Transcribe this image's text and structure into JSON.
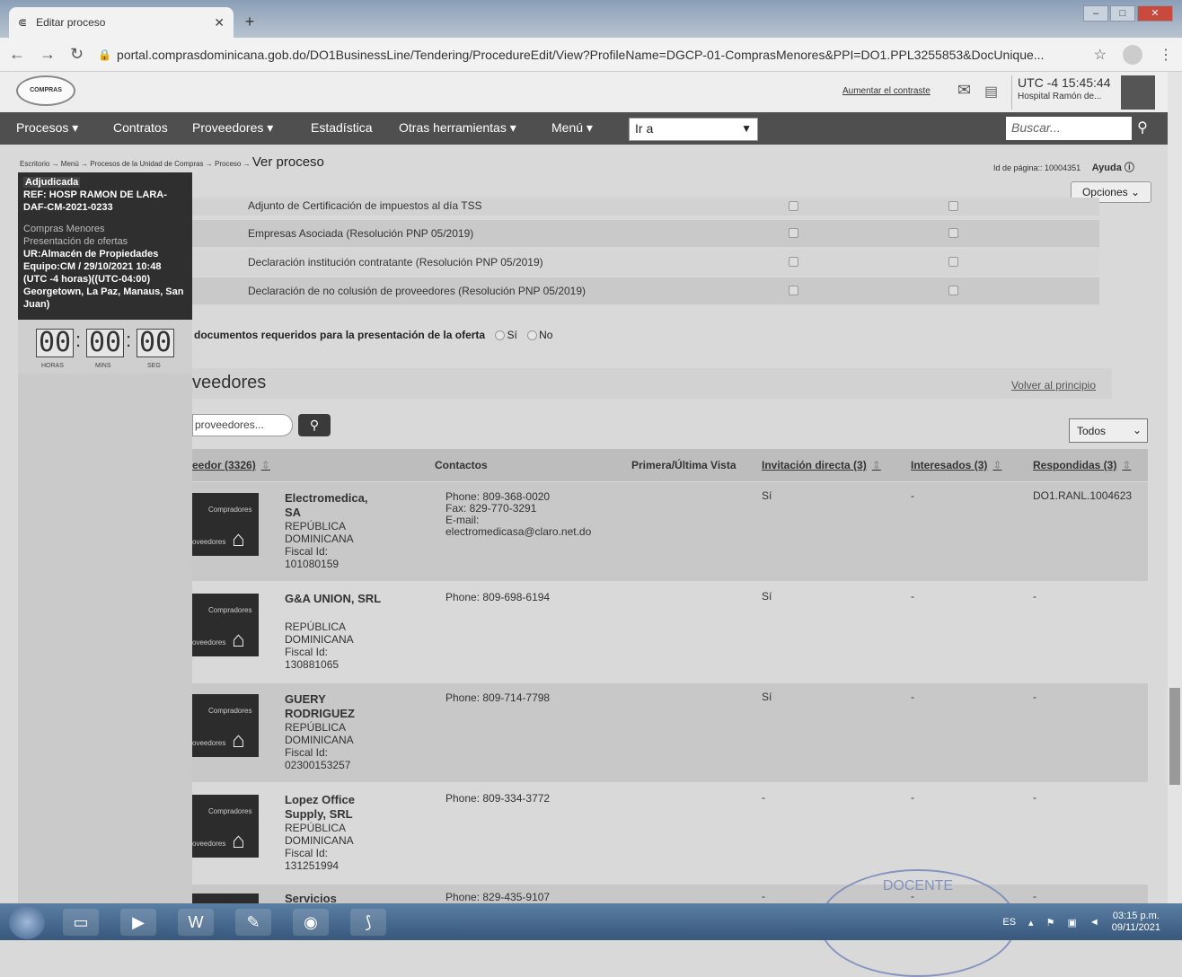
{
  "browser": {
    "tab_title": "Editar proceso",
    "url": "portal.comprasdominicana.gob.do/DO1BusinessLine/Tendering/ProcedureEdit/View?ProfileName=DGCP-01-ComprasMenores&PPI=DO1.PPL3255853&DocUnique..."
  },
  "header": {
    "logo_text": "COMPRAS DOMINICANA",
    "contrast_link": "Aumentar el contraste",
    "utc_time": "UTC -4 15:45:44",
    "hospital": "Hospital Ramón de..."
  },
  "menu": {
    "items": [
      "Procesos",
      "Contratos",
      "Proveedores",
      "Estadística",
      "Otras herramientas",
      "Menú"
    ],
    "goto_value": "Ir a",
    "search_placeholder": "Buscar..."
  },
  "breadcrumb": {
    "items": [
      "Escritorio",
      "Menú",
      "Procesos de la Unidad de Compras",
      "Proceso"
    ],
    "current": "Ver proceso",
    "page_id_label": "Id de página:: 10004351",
    "help": "Ayuda"
  },
  "options_label": "Opciones",
  "info_panel": {
    "status": "Adjudicada",
    "ref": "REF: HOSP RAMON DE LARA-DAF-CM-2021-0233",
    "type": "Compras Menores",
    "phase": "Presentación de ofertas",
    "unit": "UR:Almacén de Propiedades Equipo:CM / 29/10/2021 10:48 (UTC -4 horas)((UTC-04:00) Georgetown, La Paz, Manaus, San Juan)"
  },
  "timer": {
    "hours": "00",
    "mins": "00",
    "secs": "00",
    "label_hours": "HORAS",
    "label_mins": "MINS",
    "label_secs": "SEG"
  },
  "documents": [
    "Adjunto de Certificación de impuestos al día TSS",
    "Empresas Asociada (Resolución PNP 05/2019)",
    "Declaración institución contratante (Resolución PNP 05/2019)",
    "Declaración de no colusión de proveedores (Resolución PNP 05/2019)"
  ],
  "required_question": {
    "text": "documentos requeridos para la presentación de la oferta",
    "yes": "Sí",
    "no": "No"
  },
  "providers_section": {
    "title": "veedores",
    "back_to_top": "Volver al principio",
    "search_value": "proveedores...",
    "filter_value": "Todos"
  },
  "table": {
    "headers": {
      "provider": "eedor (3326)",
      "contacts": "Contactos",
      "first_last_view": "Primera/Última Vista",
      "direct_invitation": "Invitación directa (3)",
      "interested": "Interesados (3)",
      "responded": "Respondidas (3)"
    },
    "logo_text_top": "Compradores",
    "logo_text_bottom": "oveedores",
    "rows": [
      {
        "name": "Electromedica, SA",
        "country": "REPÚBLICA DOMINICANA",
        "fiscal_label": "Fiscal Id:",
        "fiscal_id": "101080159",
        "phone": "Phone: 809-368-0020",
        "fax": "Fax: 829-770-3291",
        "email_label": "E-mail:",
        "email": "electromedicasa@claro.net.do",
        "invited": "Sí",
        "interested": "-",
        "responded": "DO1.RANL.1004623"
      },
      {
        "name": "G&A UNION, SRL",
        "country": "REPÚBLICA DOMINICANA",
        "fiscal_label": "Fiscal Id:",
        "fiscal_id": "130881065",
        "phone": "Phone: 809-698-6194",
        "invited": "Sí",
        "interested": "-",
        "responded": "-"
      },
      {
        "name": "GUERY RODRIGUEZ",
        "country": "REPÚBLICA DOMINICANA",
        "fiscal_label": "Fiscal Id:",
        "fiscal_id": "02300153257",
        "phone": "Phone: 809-714-7798",
        "invited": "Sí",
        "interested": "-",
        "responded": "-"
      },
      {
        "name": "Lopez Office Supply, SRL",
        "country": "REPÚBLICA DOMINICANA",
        "fiscal_label": "Fiscal Id:",
        "fiscal_id": "131251994",
        "phone": "Phone: 809-334-3772",
        "invited": "-",
        "interested": "-",
        "responded": "-"
      },
      {
        "name": "Servicios",
        "phone": "Phone: 829-435-9107",
        "invited": "-",
        "interested": "-",
        "responded": "-"
      }
    ]
  },
  "stamp_text": "DOCENTE",
  "taskbar": {
    "lang": "ES",
    "time": "03:15 p.m.",
    "date": "09/11/2021"
  }
}
